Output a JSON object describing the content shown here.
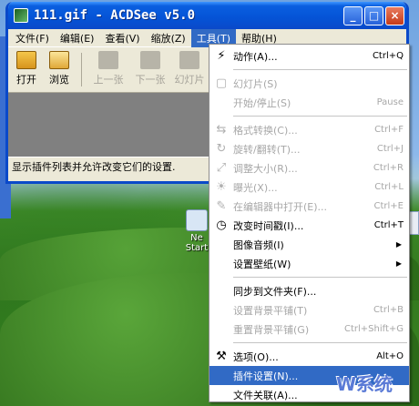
{
  "window": {
    "title": "111.gif - ACDSee v5.0",
    "buttons": {
      "minimize": "_",
      "maximize": "□",
      "close": "×"
    }
  },
  "menubar": [
    {
      "label": "文件(F)"
    },
    {
      "label": "编辑(E)"
    },
    {
      "label": "查看(V)"
    },
    {
      "label": "缩放(Z)"
    },
    {
      "label": "工具(T)",
      "active": true
    },
    {
      "label": "帮助(H)"
    }
  ],
  "toolbar": {
    "open": "打开",
    "browse": "浏览",
    "prev": "上一张",
    "next": "下一张",
    "slideshow": "幻灯片"
  },
  "statusbar": {
    "text": "显示插件列表并允许改变它们的设置."
  },
  "desktop": {
    "icon_labels": [
      "Ne",
      "Start"
    ]
  },
  "tools_menu": [
    {
      "icon": "lightning-icon",
      "glyph": "⚡",
      "label": "动作(A)...",
      "shortcut": "Ctrl+Q",
      "disabled": false
    },
    {
      "type": "separator"
    },
    {
      "icon": "slideshow-icon",
      "glyph": "▢",
      "label": "幻灯片(S)",
      "shortcut": "",
      "disabled": true
    },
    {
      "icon": "",
      "glyph": "",
      "label": "开始/停止(S)",
      "shortcut": "Pause",
      "disabled": true
    },
    {
      "type": "separator"
    },
    {
      "icon": "convert-icon",
      "glyph": "⇆",
      "label": "格式转换(C)...",
      "shortcut": "Ctrl+F",
      "disabled": true
    },
    {
      "icon": "rotate-icon",
      "glyph": "↻",
      "label": "旋转/翻转(T)...",
      "shortcut": "Ctrl+J",
      "disabled": true
    },
    {
      "icon": "resize-icon",
      "glyph": "⤢",
      "label": "调整大小(R)...",
      "shortcut": "Ctrl+R",
      "disabled": true
    },
    {
      "icon": "exposure-icon",
      "glyph": "☀",
      "label": "曝光(X)...",
      "shortcut": "Ctrl+L",
      "disabled": true
    },
    {
      "icon": "editor-icon",
      "glyph": "✎",
      "label": "在编辑器中打开(E)...",
      "shortcut": "Ctrl+E",
      "disabled": true
    },
    {
      "icon": "clock-icon",
      "glyph": "◷",
      "label": "改变时间戳(I)...",
      "shortcut": "Ctrl+T",
      "disabled": false
    },
    {
      "icon": "",
      "glyph": "",
      "label": "图像音频(I)",
      "shortcut": "",
      "disabled": false,
      "submenu": true
    },
    {
      "icon": "",
      "glyph": "",
      "label": "设置壁纸(W)",
      "shortcut": "",
      "disabled": false,
      "submenu": true
    },
    {
      "type": "separator"
    },
    {
      "icon": "",
      "glyph": "",
      "label": "同步到文件夹(F)...",
      "shortcut": "",
      "disabled": false
    },
    {
      "icon": "",
      "glyph": "",
      "label": "设置背景平铺(T)",
      "shortcut": "Ctrl+B",
      "disabled": true
    },
    {
      "icon": "",
      "glyph": "",
      "label": "重置背景平铺(G)",
      "shortcut": "Ctrl+Shift+G",
      "disabled": true
    },
    {
      "type": "separator"
    },
    {
      "icon": "options-icon",
      "glyph": "⚒",
      "label": "选项(O)...",
      "shortcut": "Alt+O",
      "disabled": false
    },
    {
      "icon": "",
      "glyph": "",
      "label": "插件设置(N)...",
      "shortcut": "",
      "disabled": false,
      "highlight": true
    },
    {
      "icon": "",
      "glyph": "",
      "label": "文件关联(A)...",
      "shortcut": "",
      "disabled": false
    }
  ],
  "watermark": {
    "text": "W系统"
  }
}
